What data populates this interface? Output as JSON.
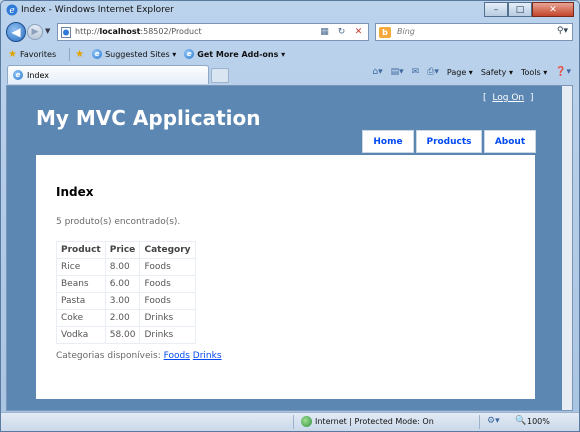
{
  "window": {
    "title": "Index - Windows Internet Explorer",
    "minimize": "–",
    "maximize": "□",
    "close": "✕"
  },
  "address": {
    "url_prefix": "http://",
    "url_host": "localhost",
    "url_rest": ":58502/Product",
    "search_placeholder": "Bing"
  },
  "favorites": {
    "favorites_label": "Favorites",
    "suggested_label": "Suggested Sites ▾",
    "addons_label": "Get More Add-ons ▾"
  },
  "tab": {
    "label": "Index"
  },
  "commandbar": {
    "page": "Page",
    "safety": "Safety",
    "tools": "Tools"
  },
  "site": {
    "title": "My MVC Application",
    "login_open": "[",
    "login_link": "Log On",
    "login_close": "]",
    "menu": [
      {
        "label": "Home"
      },
      {
        "label": "Products"
      },
      {
        "label": "About"
      }
    ]
  },
  "page": {
    "heading": "Index",
    "count_text": "5 produto(s) encontrado(s).",
    "table": {
      "headers": [
        "Product",
        "Price",
        "Category"
      ],
      "rows": [
        [
          "Rice",
          "8.00",
          "Foods"
        ],
        [
          "Beans",
          "6.00",
          "Foods"
        ],
        [
          "Pasta",
          "3.00",
          "Foods"
        ],
        [
          "Coke",
          "2.00",
          "Drinks"
        ],
        [
          "Vodka",
          "58.00",
          "Drinks"
        ]
      ]
    },
    "categories_label": "Categorias disponíveis:",
    "categories": [
      "Foods",
      "Drinks"
    ]
  },
  "status": {
    "zone_text": "Internet | Protected Mode: On",
    "zoom": "100%"
  },
  "colors": {
    "page_background": "#5c87b2",
    "link": "#034af3"
  }
}
